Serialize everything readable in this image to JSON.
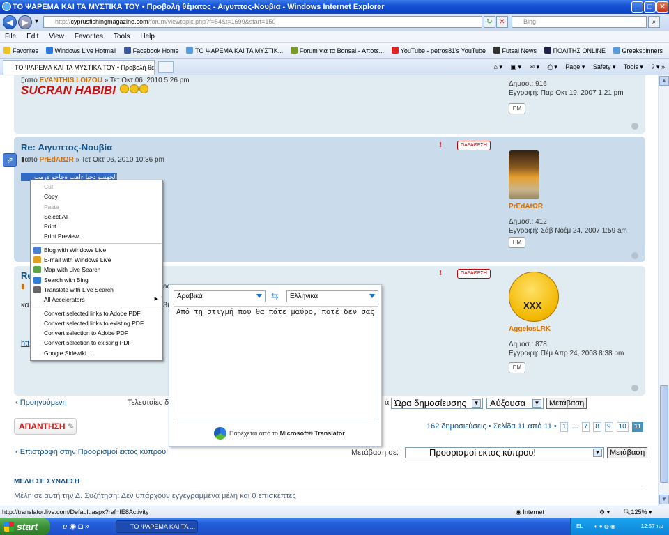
{
  "window": {
    "title": "ΤΟ ΨΑΡΕΜΑ ΚΑΙ ΤΑ ΜΥΣΤΙΚΑ ΤΟΥ • Προβολή θέματος - Αιγυπτος-Νουβια - Windows Internet Explorer",
    "min": "_",
    "max": "□",
    "close": "✕"
  },
  "address": {
    "url_host": "cyprusfishingmagazine.com",
    "url_path": "/forum/viewtopic.php?f=54&t=1699&start=150",
    "url_prefix": "http://",
    "search_placeholder": "Bing"
  },
  "menu": [
    "File",
    "Edit",
    "View",
    "Favorites",
    "Tools",
    "Help"
  ],
  "favorites": [
    "Favorites",
    "Windows Live Hotmail",
    "Facebook Home",
    "ΤΟ ΨΑΡΕΜΑ ΚΑΙ ΤΑ ΜΥΣΤΙΚ...",
    "Forum για τα Bonsai - Αποτε...",
    "YouTube - petros81's YouTube",
    "Futsal News",
    "ΠΟΛΙΤΗΣ ONLINE",
    "Greekspinners"
  ],
  "tab": {
    "label": "ΤΟ ΨΑΡΕΜΑ ΚΑΙ ΤΑ ΜΥΣΤΙΚΑ ΤΟΥ • Προβολή θέματο..."
  },
  "commands": [
    "Page ▾",
    "Safety ▾",
    "Tools ▾"
  ],
  "post1": {
    "by_prefix": "από",
    "author": "EVANTHIS LOIZOU",
    "date": "» Τετ Οκτ 06, 2010 5:26 pm",
    "body": "SUCRAN HABIBI",
    "posts_label": "Δημοσ.: 916",
    "joined": "Εγγραφή: Παρ Οκτ 19, 2007 1:21 pm",
    "pm": "ΠΜ"
  },
  "post2": {
    "title": "Re: Αιγυπτος-Νουβία",
    "by_prefix": "από",
    "author": "PrEdAtΩR",
    "date": "» Τετ Οκτ 06, 2010 10:36 pm",
    "selected": "الحهسو دحبا ءاهب ةجاحو ةرمب",
    "report": "ΠΑΡΑΘΕΣΗ",
    "name": "PrEdAtΩR",
    "posts_label": "Δημοσ.: 412",
    "joined": "Εγγραφή: Σάβ Νοέμ 24, 2007 1:59 am",
    "pm": "ΠΜ"
  },
  "post3": {
    "title_partial": "Re",
    "line1_partial": "κα",
    "line1_tail": "3ι",
    "link_partial": "htt",
    "by_tail": "ac",
    "report": "ΠΑΡΑΘΕΣΗ",
    "name": "AggelosLRK",
    "avatar_text": "XXX",
    "posts_label": "Δημοσ.: 878",
    "joined": "Εγγραφή: Πέμ Απρ 24, 2008 8:38 pm",
    "pm": "ΠΜ"
  },
  "nav": {
    "prev": "Προηγούμενη",
    "last_partial": "Τελευταίες δ",
    "sort_suffix": "ά",
    "sort_field": "Ώρα δημοσίευσης",
    "sort_dir": "Αύξουσα",
    "go": "Μετάβαση",
    "reply": "ΑΠΑΝΤΗΣΗ",
    "pagination_text": "162 δημοσιεύσεις • Σελίδα 11 από 11 •",
    "pages": [
      "1",
      "...",
      "7",
      "8",
      "9",
      "10",
      "11"
    ],
    "back": "Επιστροφή στην Προορισμοί εκτος κύπρου!",
    "jump_label": "Μετάβαση σε:",
    "jump_value": "Προορισμοί εκτος κύπρου!",
    "jump_go": "Μετάβαση"
  },
  "online": {
    "title": "ΜΕΛΗ ΣΕ ΣΥΝΔΕΣΗ",
    "text": "Μέλη σε αυτή την Δ. Συζήτηση: Δεν υπάρχουν εγγεγραμμένα μέλη και 0 επισκέπτες"
  },
  "context_menu": [
    {
      "label": "Cut",
      "disabled": true
    },
    {
      "label": "Copy"
    },
    {
      "label": "Paste",
      "disabled": true
    },
    {
      "label": "Select All"
    },
    {
      "label": "Print..."
    },
    {
      "label": "Print Preview..."
    },
    {
      "sep": true
    },
    {
      "label": "Blog with Windows Live",
      "icon": "#4a7fd6"
    },
    {
      "label": "E-mail with Windows Live",
      "icon": "#e0a020"
    },
    {
      "label": "Map with Live Search",
      "icon": "#5ca34a"
    },
    {
      "label": "Search with Bing",
      "icon": "#2f7fd4"
    },
    {
      "label": "Translate with Live Search",
      "icon": "#666"
    },
    {
      "label": "All Accelerators",
      "submenu": true
    },
    {
      "sep": true
    },
    {
      "label": "Convert selected links to Adobe PDF"
    },
    {
      "label": "Convert selected links to existing PDF"
    },
    {
      "label": "Convert selection to Adobe PDF"
    },
    {
      "label": "Convert selection to existing PDF"
    },
    {
      "label": "Google Sidewiki..."
    }
  ],
  "translator": {
    "from": "Αραβικά",
    "to": "Ελληνικά",
    "text": "Από τη στιγμή που θα πάτε μαύρο, ποτέ δεν σας",
    "footer_prefix": "Παρέχεται από το",
    "footer_brand": "Microsoft® Translator"
  },
  "status": {
    "url": "http://translator.live.com/Default.aspx?ref=IE8Activity",
    "zone": "Internet",
    "zoom": "125%"
  },
  "taskbar": {
    "start": "start",
    "item": "ΤΟ ΨΑΡΕΜΑ ΚΑΙ ΤΑ ...",
    "lang": "EL",
    "time": "12:57 πμ"
  }
}
